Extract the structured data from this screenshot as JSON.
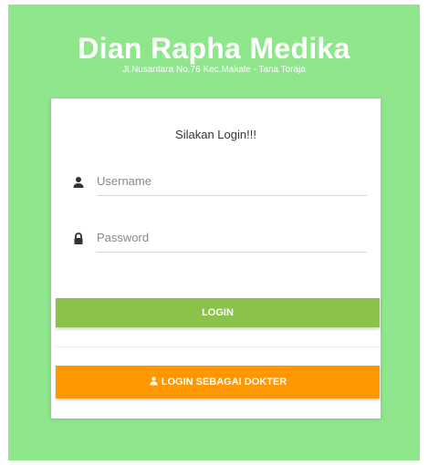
{
  "header": {
    "title": "Dian Rapha Medika",
    "address": "Jl.Nusantara No.76 Kec.Makale - Tana Toraja"
  },
  "login_card": {
    "title": "Silakan Login!!!",
    "username": {
      "icon": "user-icon",
      "placeholder": "Username",
      "value": ""
    },
    "password": {
      "icon": "lock-icon",
      "placeholder": "Password",
      "value": ""
    },
    "login_button_label": "LOGIN",
    "doctor_button": {
      "icon": "user-icon",
      "label": "LOGIN SEBAGAI DOKTER"
    }
  },
  "colors": {
    "background": "#8fe68d",
    "login_button": "#8bc34a",
    "doctor_button": "#ff9800",
    "text_on_button": "#ffffff"
  }
}
